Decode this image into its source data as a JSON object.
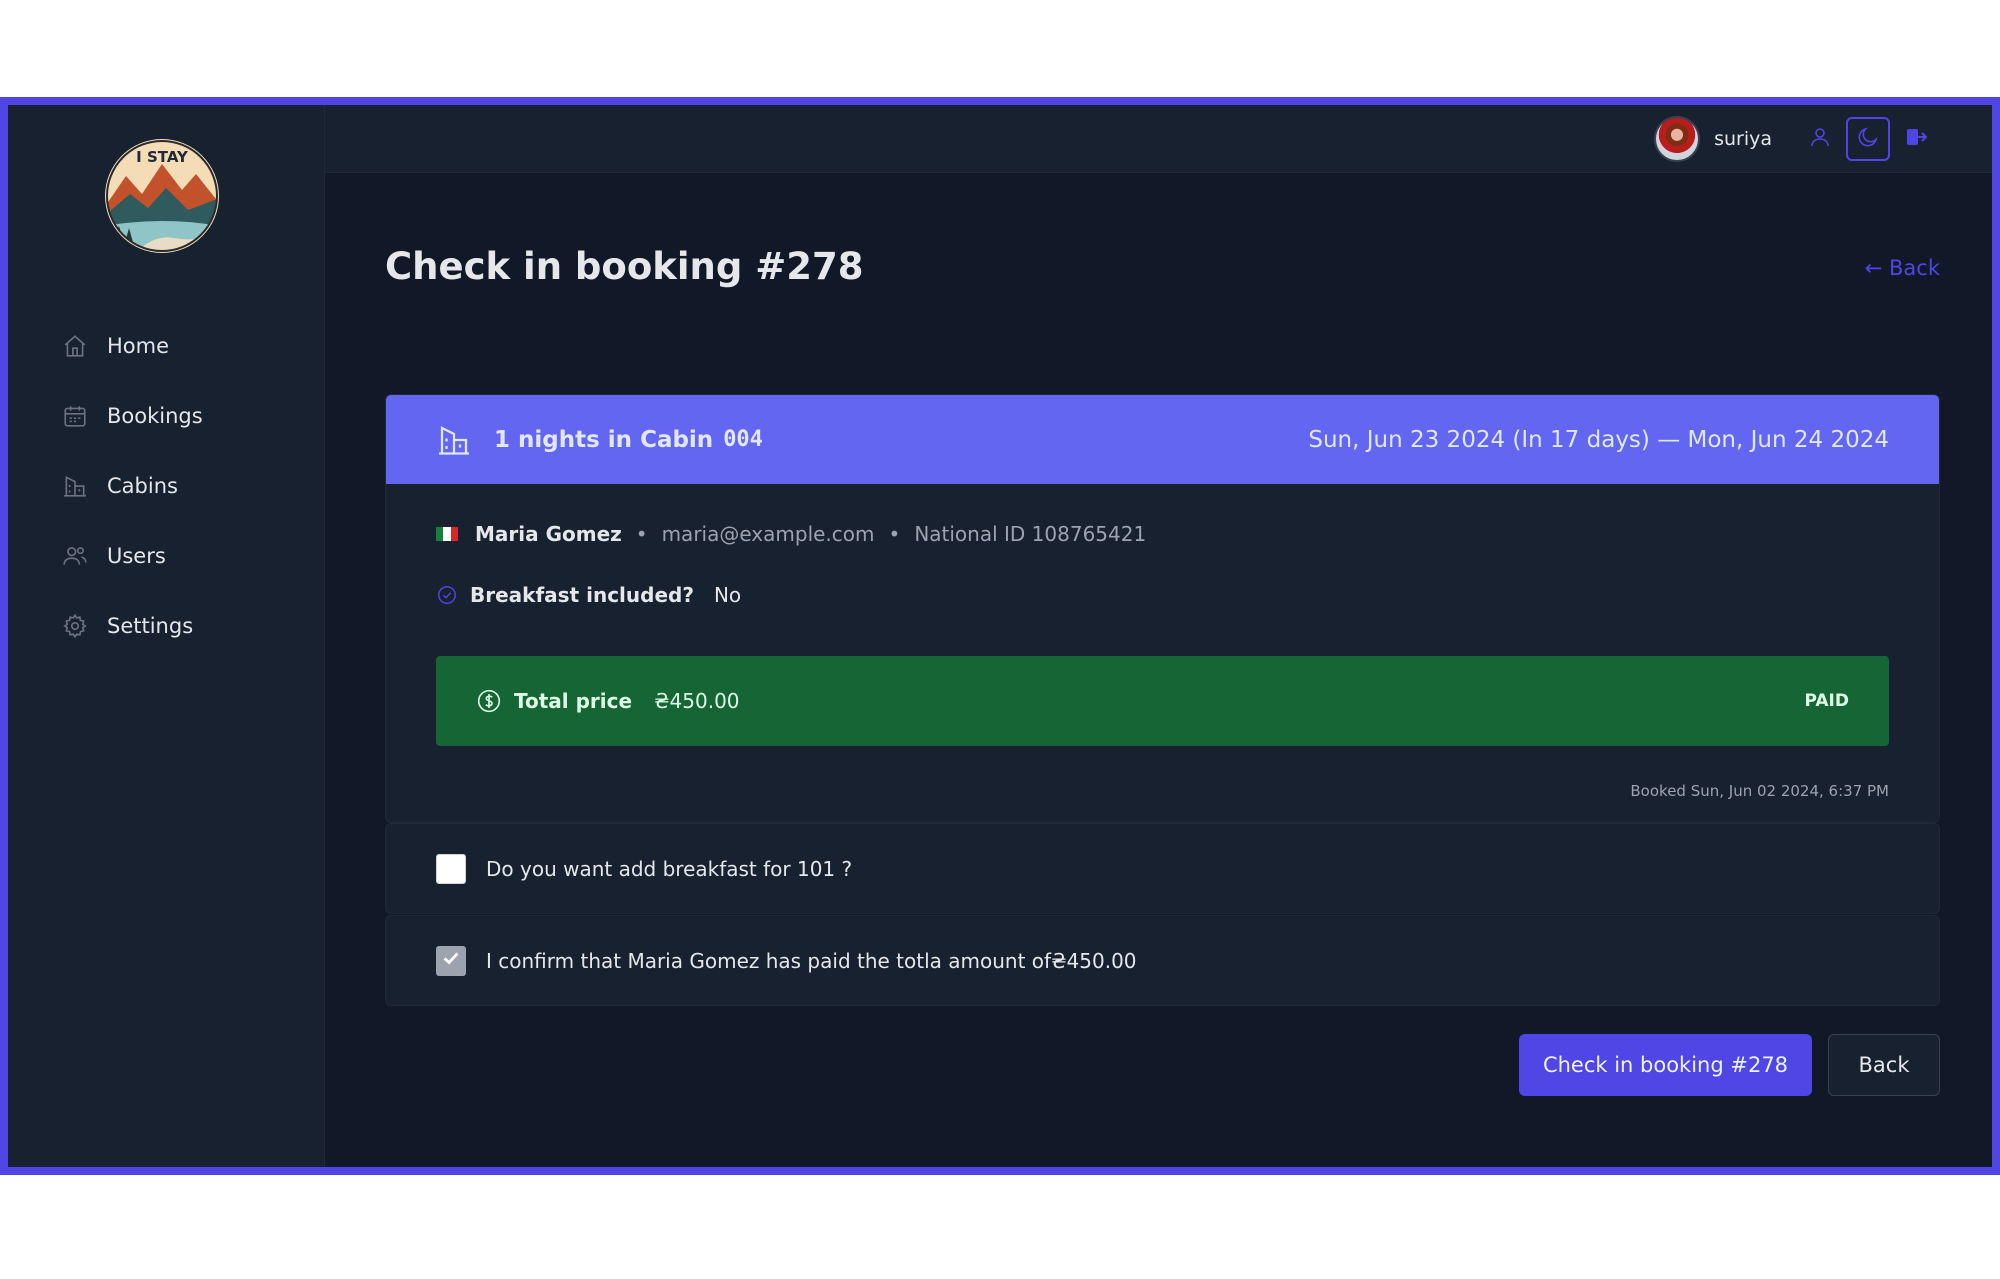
{
  "sidebar": {
    "logo_text": "I STAY",
    "items": [
      {
        "label": "Home",
        "icon": "home-icon"
      },
      {
        "label": "Bookings",
        "icon": "calendar-icon"
      },
      {
        "label": "Cabins",
        "icon": "building-icon"
      },
      {
        "label": "Users",
        "icon": "users-icon"
      },
      {
        "label": "Settings",
        "icon": "gear-icon"
      }
    ]
  },
  "header": {
    "username": "suriya",
    "icons": [
      "user-icon",
      "moon-icon",
      "logout-icon"
    ]
  },
  "page": {
    "title": "Check in booking #278",
    "back_link": "← Back"
  },
  "booking": {
    "nights_text": "1 nights in Cabin",
    "cabin_number": "004",
    "date_range": "Sun, Jun 23 2024 (In 17 days) — Mon, Jun 24 2024",
    "guest_name": "Maria Gomez",
    "separator": "•",
    "guest_email": "maria@example.com",
    "national_id": "National ID 108765421",
    "breakfast_label": "Breakfast included?",
    "breakfast_value": "No",
    "total_price_label": "Total price",
    "total_price_value": "₴450.00",
    "paid_status": "PAID",
    "booked_at": "Booked Sun, Jun 02 2024, 6:37 PM"
  },
  "checkboxes": {
    "add_breakfast": {
      "label": "Do you want add breakfast for 101 ?",
      "checked": false
    },
    "confirm_paid": {
      "label": "I confirm that Maria Gomez has paid the totla amount of₴450.00",
      "checked": true
    }
  },
  "actions": {
    "primary": "Check in booking #278",
    "secondary": "Back"
  },
  "colors": {
    "accent": "#4f46e5",
    "header_band": "#6366f1",
    "paid_green": "#166534",
    "background": "#111827",
    "panel": "#18212f"
  }
}
